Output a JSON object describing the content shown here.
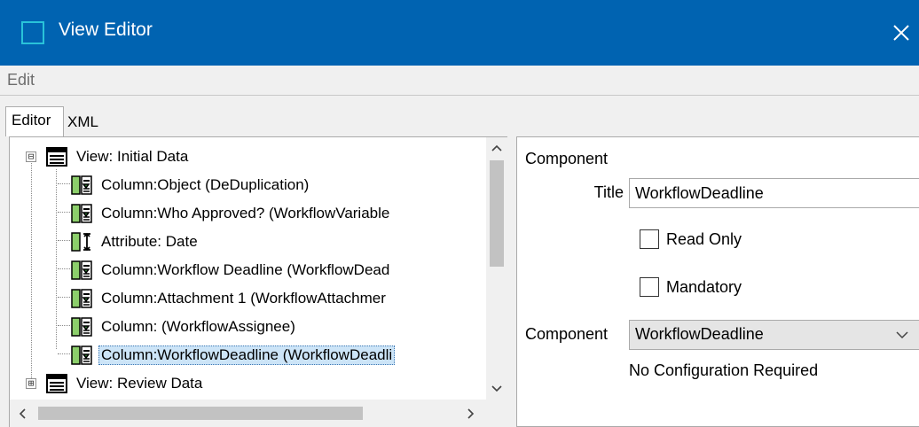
{
  "window": {
    "title": "View Editor",
    "app_icon": "window-square-icon",
    "close_icon": "close-x-icon",
    "titlebar_color": "#0063b1"
  },
  "menu": {
    "edit_label": "Edit"
  },
  "tabs": {
    "editor_label": "Editor",
    "xml_label": "XML"
  },
  "tree": {
    "nodes": [
      {
        "label": "View: Initial Data",
        "icon": "view-table-icon",
        "expander": "⊟"
      },
      {
        "label": "Column:Object (DeDuplication)",
        "icon": "column-icon"
      },
      {
        "label": "Column:Who Approved? (WorkflowVariable",
        "icon": "column-icon"
      },
      {
        "label": "Attribute: Date",
        "icon": "attribute-icon"
      },
      {
        "label": "Column:Workflow Deadline (WorkflowDead",
        "icon": "column-icon"
      },
      {
        "label": "Column:Attachment 1 (WorkflowAttachmer",
        "icon": "column-icon"
      },
      {
        "label": "Column: (WorkflowAssignee)",
        "icon": "column-icon"
      },
      {
        "label": "Column:WorkflowDeadline (WorkflowDeadli",
        "icon": "column-icon",
        "selected": true
      },
      {
        "label": "View: Review Data",
        "icon": "view-table-icon",
        "expander": "⊞"
      }
    ],
    "selected_highlight": "#cce4f7"
  },
  "props": {
    "section_label": "Component",
    "title_label": "Title",
    "title_value": "WorkflowDeadline",
    "read_only_label": "Read Only",
    "read_only_checked": false,
    "mandatory_label": "Mandatory",
    "mandatory_checked": false,
    "component_label": "Component",
    "component_value": "WorkflowDeadline",
    "note": "No Configuration Required"
  }
}
